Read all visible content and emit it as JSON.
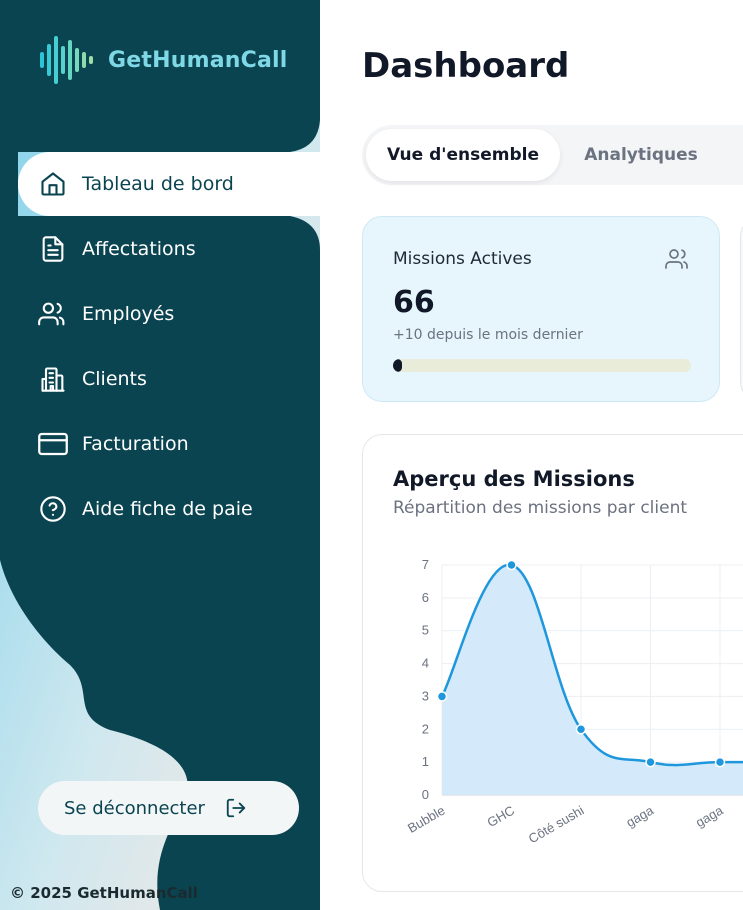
{
  "brand": {
    "name": "GetHumanCall"
  },
  "sidebar": {
    "items": [
      {
        "label": "Tableau de bord",
        "icon": "home-icon",
        "active": true
      },
      {
        "label": "Affectations",
        "icon": "document-icon"
      },
      {
        "label": "Employés",
        "icon": "users-icon"
      },
      {
        "label": "Clients",
        "icon": "building-icon"
      },
      {
        "label": "Facturation",
        "icon": "credit-card-icon"
      },
      {
        "label": "Aide fiche de paie",
        "icon": "help-circle-icon"
      }
    ],
    "logout_label": "Se déconnecter",
    "copyright": "© 2025 GetHumanCall"
  },
  "page": {
    "title": "Dashboard"
  },
  "tabs": [
    {
      "label": "Vue d'ensemble",
      "active": true
    },
    {
      "label": "Analytiques",
      "active": false
    }
  ],
  "stat_card": {
    "label": "Missions Actives",
    "value": "66",
    "subtext": "+10 depuis le mois dernier",
    "progress_fraction": 0.03,
    "icon": "users-icon"
  },
  "chart_card": {
    "title": "Aperçu des Missions",
    "subtitle": "Répartition des missions par client"
  },
  "chart_data": {
    "type": "area",
    "categories": [
      "Bubble",
      "GHC",
      "Côté sushi",
      "gaga",
      "gaga",
      ""
    ],
    "values": [
      3,
      7,
      2,
      1,
      1,
      1
    ],
    "yticks": [
      "0",
      "1",
      "2",
      "3",
      "4",
      "5",
      "6",
      "7"
    ],
    "ylim": [
      0,
      7
    ],
    "grid": true,
    "colors": {
      "line": "#1e97dc",
      "fill": "#cfe8f9"
    }
  },
  "colors": {
    "sidebar": "#0b4451",
    "accent": "#7fd8e6",
    "chart_line": "#1e97dc"
  }
}
